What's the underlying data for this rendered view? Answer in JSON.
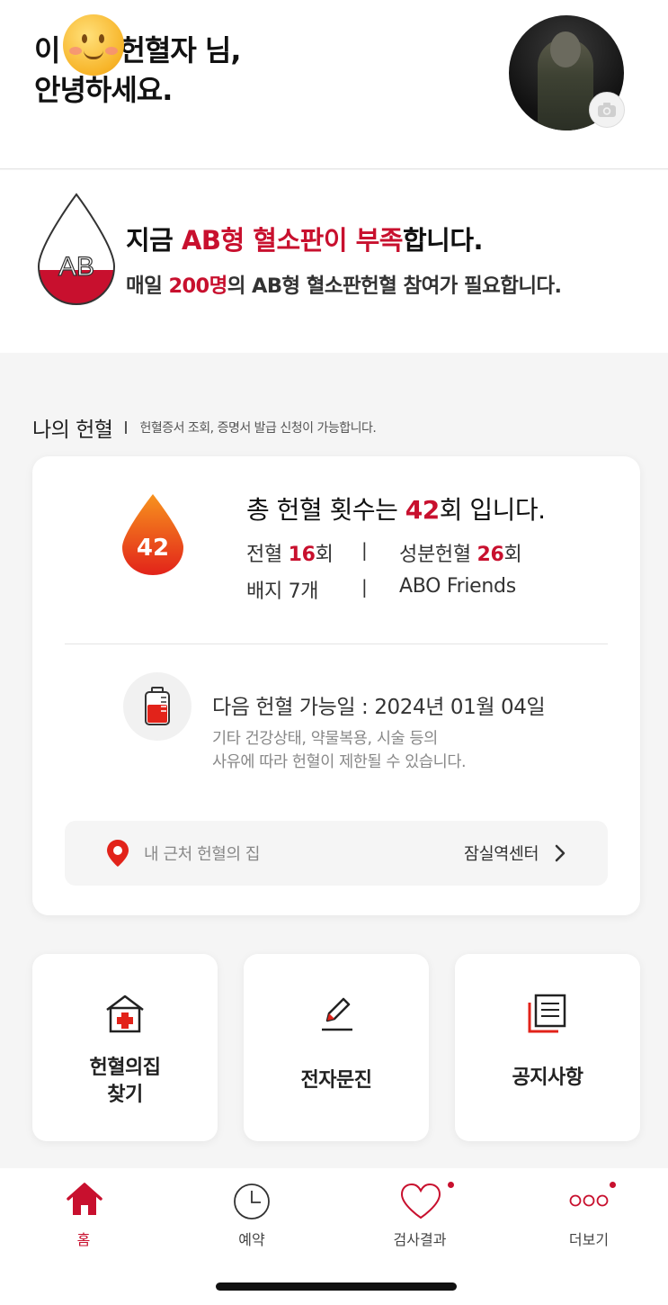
{
  "greeting": {
    "line1_prefix": "이",
    "line1_suffix": "헌혈자 님,",
    "line2": "안녕하세요."
  },
  "notice": {
    "blood_type_badge": "AB",
    "title_pre": "지금 ",
    "title_hl": "AB형 혈소판이 부족",
    "title_post": "합니다.",
    "sub_pre": "매일 ",
    "sub_hl": "200명",
    "sub_post": "의 AB형 혈소판헌혈 참여가 필요합니다."
  },
  "section": {
    "title": "나의 헌혈",
    "desc": "헌혈증서 조회, 증명서 발급 신청이 가능합니다."
  },
  "summary": {
    "count_badge": "42",
    "total_pre": "총 헌혈 횟수는 ",
    "total_num": "42",
    "total_post": "회 입니다.",
    "whole_label": "전혈 ",
    "whole_num": "16",
    "whole_unit": "회",
    "apheresis_label": "성분헌혈 ",
    "apheresis_num": "26",
    "apheresis_unit": "회",
    "badge_text": "배지 7개",
    "sep": "|",
    "group_text": "ABO Friends"
  },
  "next": {
    "date_text": "다음 헌혈 가능일 : 2024년 01월 04일",
    "note_line1": "기타 건강상태, 약물복용, 시술 등의",
    "note_line2": "사유에 따라 헌혈이 제한될 수 있습니다."
  },
  "nearby": {
    "label": "내 근처 헌혈의 집",
    "center": "잠실역센터"
  },
  "tiles": [
    {
      "line1": "헌혈의집",
      "line2": "찾기",
      "icon": "hospital-icon"
    },
    {
      "line1": "전자문진",
      "icon": "pen-icon"
    },
    {
      "line1": "공지사항",
      "icon": "document-icon"
    }
  ],
  "tabs": [
    {
      "label": "홈",
      "icon": "home-icon",
      "active": true
    },
    {
      "label": "예약",
      "icon": "clock-icon"
    },
    {
      "label": "검사결과",
      "icon": "heart-icon",
      "has_dot": true
    },
    {
      "label": "더보기",
      "icon": "more-icon",
      "has_dot": true
    }
  ],
  "colors": {
    "accent": "#c8102e",
    "drop_top": "#f7931e",
    "drop_bottom": "#e2231a",
    "background": "#f5f5f5"
  }
}
